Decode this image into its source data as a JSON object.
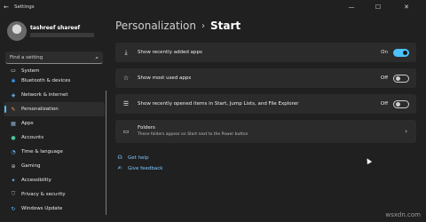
{
  "window": {
    "title": "Settings",
    "back_icon": "back-arrow-icon",
    "minimize": "—",
    "maximize": "☐",
    "close": "✕"
  },
  "user": {
    "name": "tashreef shareef"
  },
  "search": {
    "placeholder": "Find a setting",
    "icon": "search-icon"
  },
  "sidebar": {
    "items": [
      {
        "label": "System",
        "icon": "monitor-icon",
        "glyph": "▭"
      },
      {
        "label": "Bluetooth & devices",
        "icon": "bluetooth-icon",
        "glyph": "✱"
      },
      {
        "label": "Network & internet",
        "icon": "wifi-icon",
        "glyph": "◈"
      },
      {
        "label": "Personalization",
        "icon": "brush-icon",
        "glyph": "✎"
      },
      {
        "label": "Apps",
        "icon": "apps-icon",
        "glyph": "▦"
      },
      {
        "label": "Accounts",
        "icon": "person-icon",
        "glyph": "●"
      },
      {
        "label": "Time & language",
        "icon": "globe-clock-icon",
        "glyph": "◔"
      },
      {
        "label": "Gaming",
        "icon": "controller-icon",
        "glyph": "⊕"
      },
      {
        "label": "Accessibility",
        "icon": "accessibility-icon",
        "glyph": "✦"
      },
      {
        "label": "Privacy & security",
        "icon": "shield-icon",
        "glyph": "⛉"
      },
      {
        "label": "Windows Update",
        "icon": "update-icon",
        "glyph": "↻"
      }
    ],
    "active_index": 3
  },
  "page": {
    "breadcrumb_parent": "Personalization",
    "breadcrumb_sep": "›",
    "breadcrumb_current": "Start"
  },
  "settings": [
    {
      "label": "Show recently added apps",
      "state": "On",
      "icon": "download-icon",
      "glyph": "⤓"
    },
    {
      "label": "Show most used apps",
      "state": "Off",
      "icon": "star-icon",
      "glyph": "☆"
    },
    {
      "label": "Show recently opened items in Start, Jump Lists, and File Explorer",
      "state": "Off",
      "icon": "list-icon",
      "glyph": "☰"
    }
  ],
  "folders": {
    "label": "Folders",
    "description": "These folders appear on Start next to the Power button",
    "icon": "folders-icon",
    "glyph": "▭",
    "chevron": "›"
  },
  "links": [
    {
      "label": "Get help",
      "icon": "help-icon",
      "glyph": "☊"
    },
    {
      "label": "Give feedback",
      "icon": "feedback-icon",
      "glyph": "✍"
    }
  ],
  "watermark": "wsxdn.com",
  "colors": {
    "accent": "#4cc2ff",
    "background": "#202020",
    "card": "#2b2b2b",
    "link": "#7fc8ff"
  }
}
